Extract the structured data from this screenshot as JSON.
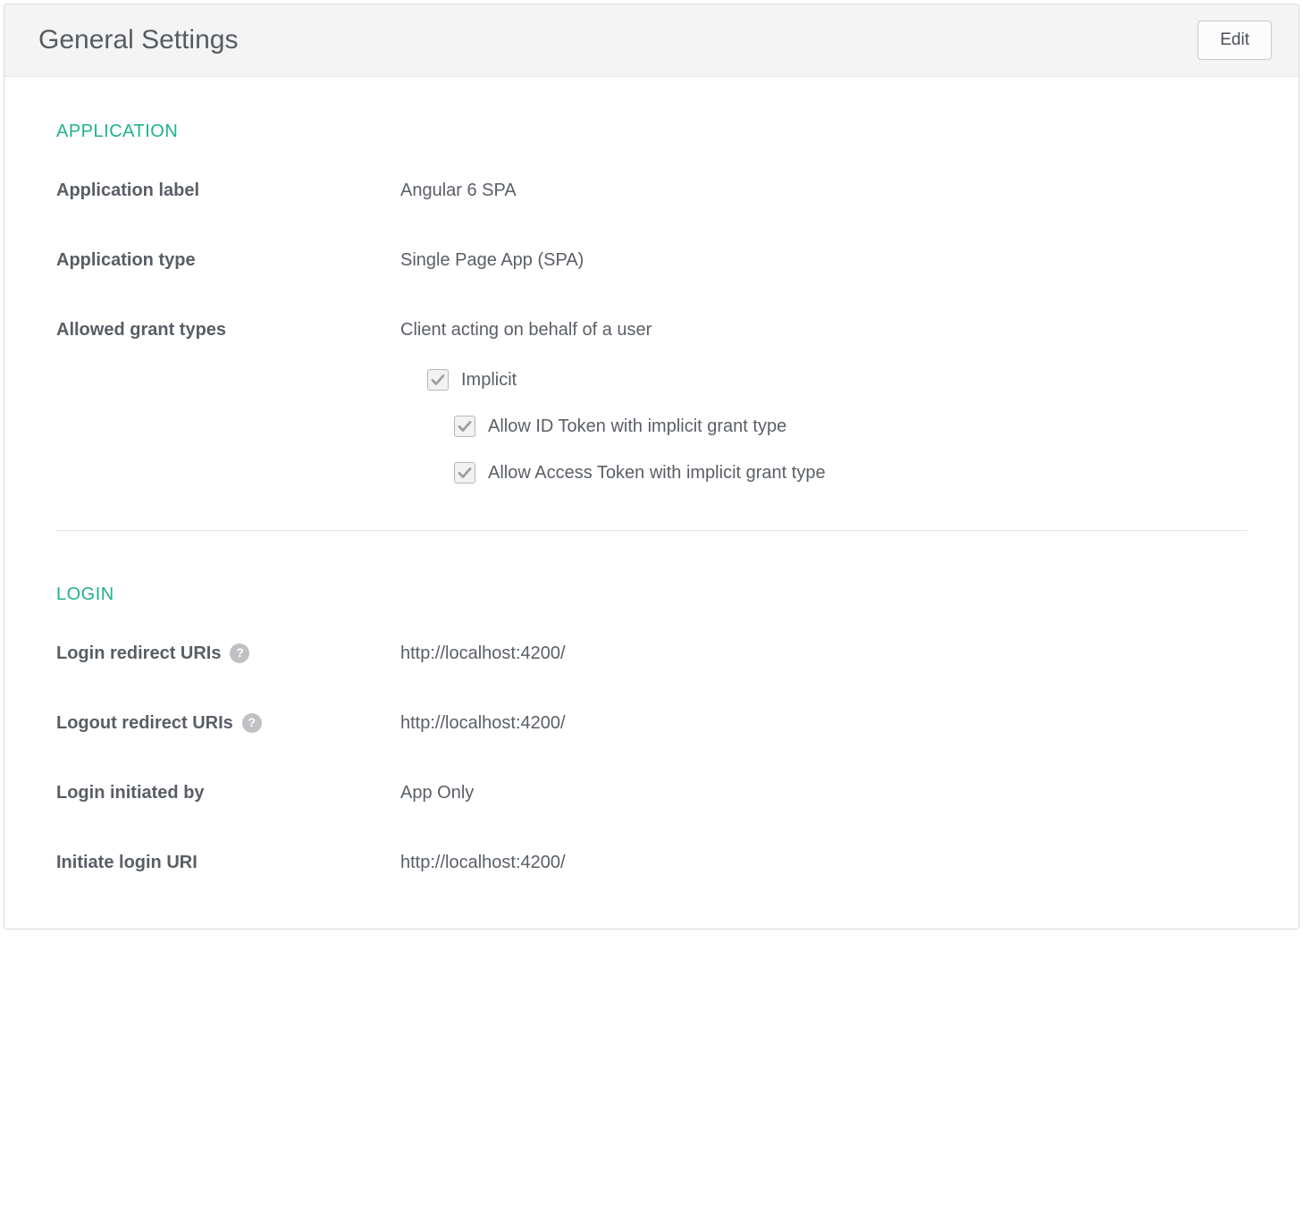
{
  "header": {
    "title": "General Settings",
    "edit_label": "Edit"
  },
  "sections": {
    "application": {
      "title": "APPLICATION",
      "app_label": {
        "label": "Application label",
        "value": "Angular 6 SPA"
      },
      "app_type": {
        "label": "Application type",
        "value": "Single Page App (SPA)"
      },
      "grant_types": {
        "label": "Allowed grant types",
        "heading": "Client acting on behalf of a user",
        "items": {
          "implicit": "Implicit",
          "allow_id": "Allow ID Token with implicit grant type",
          "allow_access": "Allow Access Token with implicit grant type"
        }
      }
    },
    "login": {
      "title": "LOGIN",
      "login_redirect": {
        "label": "Login redirect URIs",
        "value": "http://localhost:4200/"
      },
      "logout_redirect": {
        "label": "Logout redirect URIs",
        "value": "http://localhost:4200/"
      },
      "login_initiated": {
        "label": "Login initiated by",
        "value": "App Only"
      },
      "initiate_uri": {
        "label": "Initiate login URI",
        "value": "http://localhost:4200/"
      }
    }
  }
}
